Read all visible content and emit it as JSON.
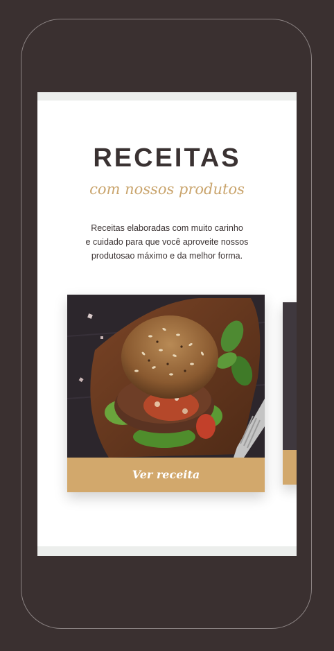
{
  "section": {
    "title": "RECEITAS",
    "subtitle": "com nossos produtos",
    "description_lines": [
      "Receitas elaboradas com muito carinho",
      "e cuidado para que você aproveite nossos",
      "produtosao máximo e da melhor forma."
    ]
  },
  "cards": [
    {
      "image": "burger-on-wooden-board",
      "button_label": "Ver receita"
    },
    {
      "image": "recipe-photo-partial",
      "button_label": ""
    }
  ],
  "colors": {
    "background": "#3a3030",
    "accent": "#d2a86c",
    "subtitle": "#c9a46c",
    "text": "#3a3232"
  }
}
